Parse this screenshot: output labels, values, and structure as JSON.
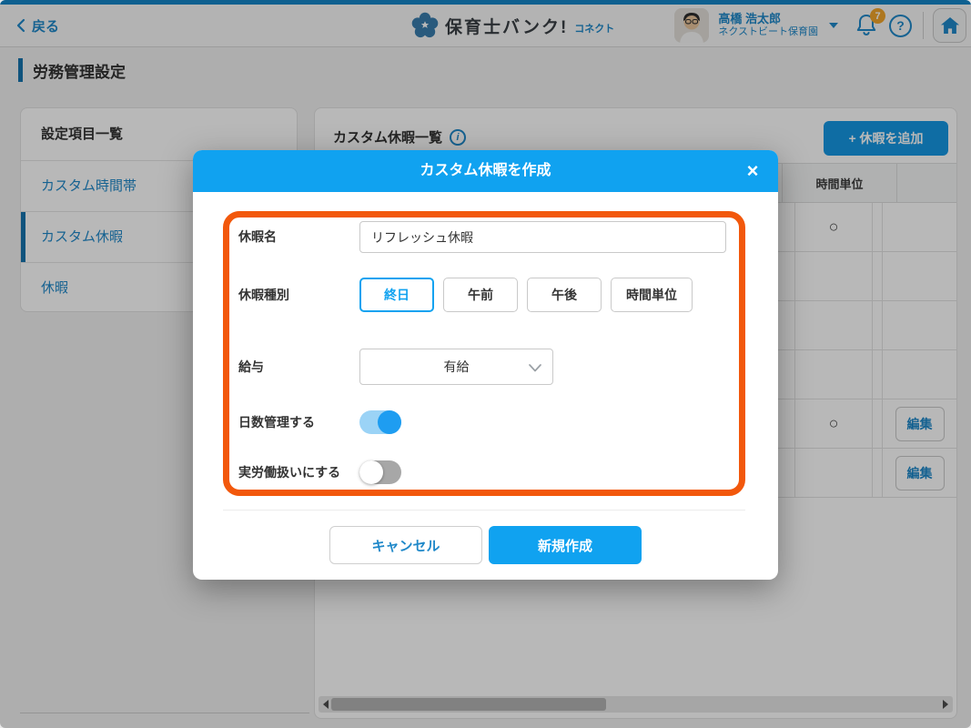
{
  "header": {
    "back_label": "戻る",
    "logo_main": "保育士バンク!",
    "logo_sub": "コネクト",
    "user_name": "高橋 浩太郎",
    "user_org": "ネクストビート保育園",
    "notification_count": "7",
    "help_glyph": "?"
  },
  "page": {
    "title": "労務管理設定"
  },
  "sidebar": {
    "title": "設定項目一覧",
    "items": [
      {
        "label": "カスタム時間帯",
        "active": false
      },
      {
        "label": "カスタム休暇",
        "active": true
      },
      {
        "label": "休暇",
        "active": false
      }
    ]
  },
  "main": {
    "title": "カスタム休暇一覧",
    "info_glyph": "i",
    "add_button_label": "+ 休暇を追加",
    "table": {
      "header_time_unit": "時間単位",
      "rows": [
        {
          "time_unit": "○"
        },
        {
          "time_unit": ""
        },
        {
          "time_unit": ""
        },
        {
          "time_unit": ""
        },
        {
          "time_unit": "○",
          "edit_label": "編集"
        },
        {
          "time_unit": "",
          "edit_label": "編集"
        }
      ]
    }
  },
  "modal": {
    "title": "カスタム休暇を作成",
    "close_glyph": "×",
    "fields": {
      "name_label": "休暇名",
      "name_value": "リフレッシュ休暇",
      "type_label": "休暇種別",
      "type_options": [
        "終日",
        "午前",
        "午後",
        "時間単位"
      ],
      "type_selected": "終日",
      "pay_label": "給与",
      "pay_value": "有給",
      "days_label": "日数管理する",
      "days_on": true,
      "actual_label": "実労働扱いにする",
      "actual_on": false
    },
    "cancel_label": "キャンセル",
    "submit_label": "新規作成"
  },
  "colors": {
    "accent_blue": "#10a2f0",
    "link_blue": "#1f88c9",
    "highlight_orange": "#f2580c",
    "badge_orange": "#f1a52b",
    "active_tab_bar": "#1573ad"
  }
}
